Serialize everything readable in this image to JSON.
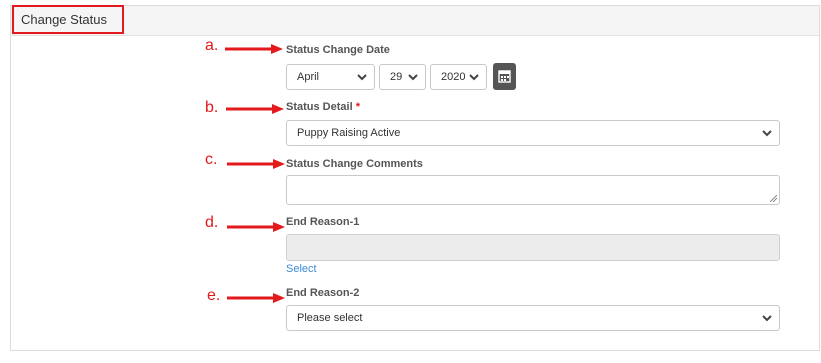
{
  "panel": {
    "title": "Change Status"
  },
  "markers": [
    "a.",
    "b.",
    "c.",
    "d.",
    "e."
  ],
  "fields": {
    "status_change_date": {
      "label": "Status Change Date",
      "month": "April",
      "day": "29",
      "year": "2020"
    },
    "status_detail": {
      "label": "Status Detail",
      "required_mark": "*",
      "value": "Puppy Raising Active"
    },
    "status_change_comments": {
      "label": "Status Change Comments",
      "value": ""
    },
    "end_reason_1": {
      "label": "End Reason-1",
      "value": "",
      "select_link": "Select"
    },
    "end_reason_2": {
      "label": "End Reason-2",
      "value": "Please select"
    }
  },
  "icons": {
    "calendar": "calendar-icon",
    "chevron": "chevron-down-icon",
    "arrow": "red-arrow-icon"
  },
  "colors": {
    "annotation_red": "#e3191c",
    "link_blue": "#3a8bd6",
    "calendar_button": "#555555",
    "disabled_field": "#ececec"
  }
}
